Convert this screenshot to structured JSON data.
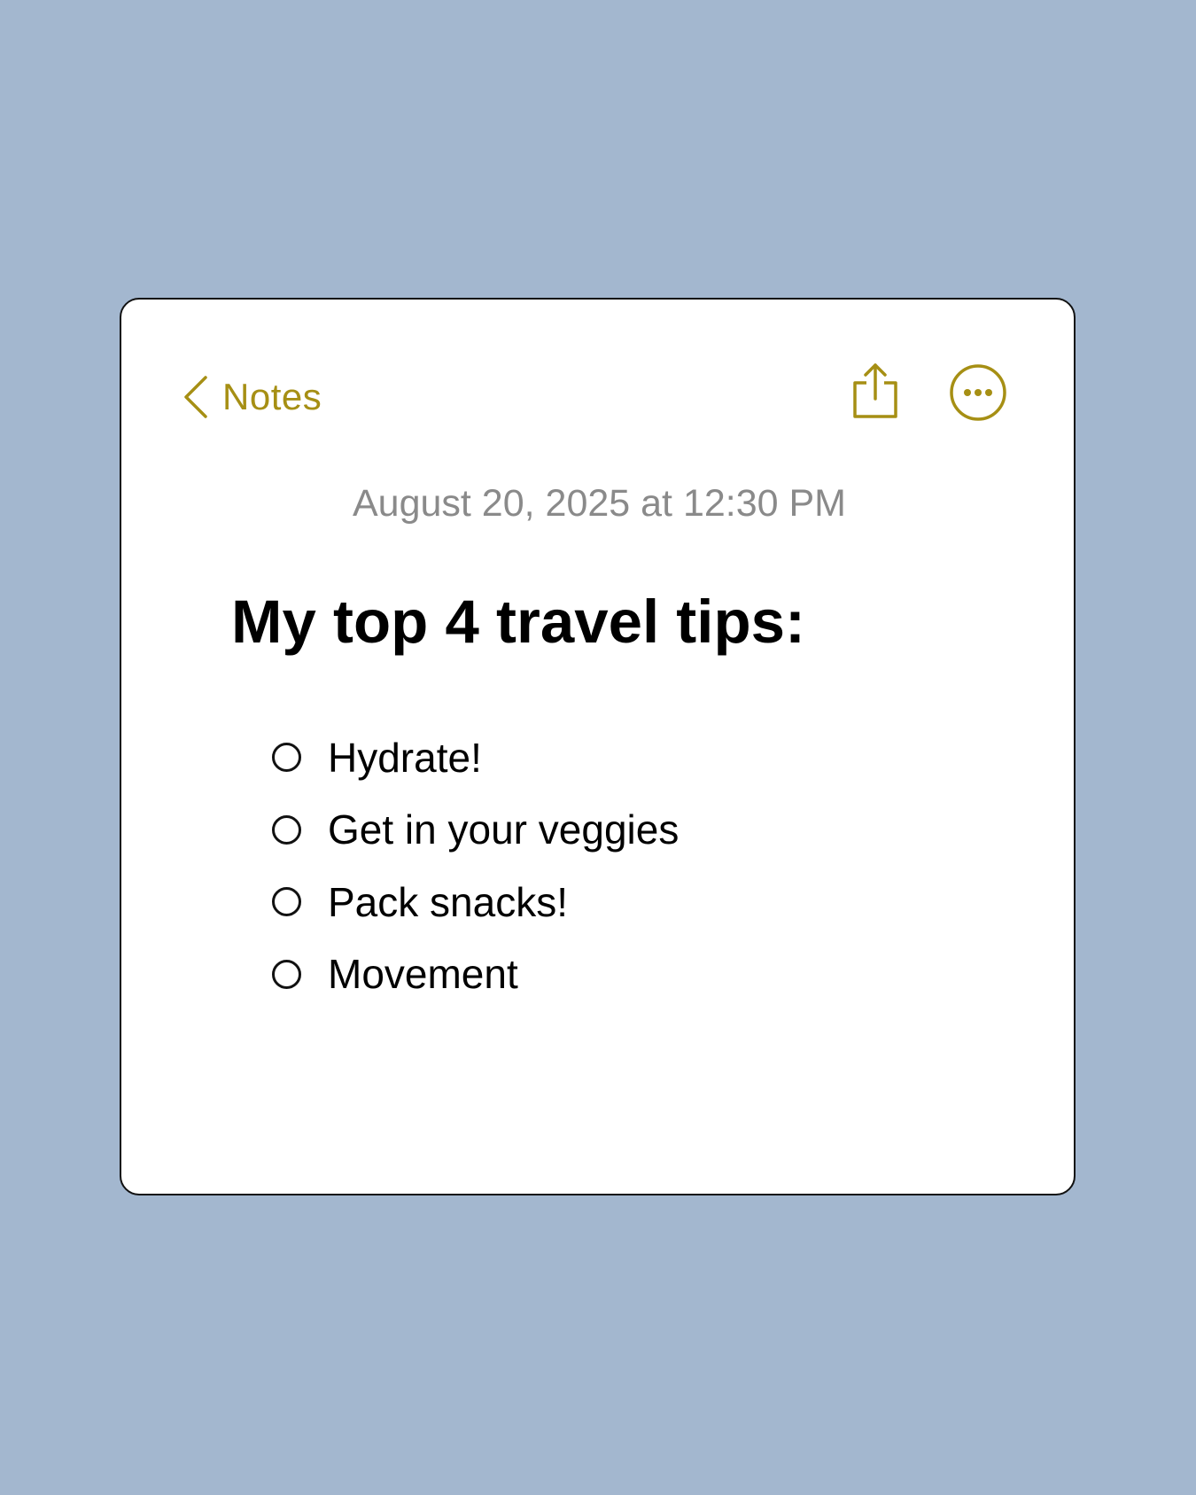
{
  "colors": {
    "background": "#a3b7cf",
    "card": "#ffffff",
    "accent": "#a68f14",
    "timestamp": "#8a8a8a",
    "text": "#000000"
  },
  "nav": {
    "back_label": "Notes",
    "back_icon": "chevron-left-icon",
    "share_icon": "share-icon",
    "more_icon": "more-ellipsis-icon"
  },
  "note": {
    "timestamp": "August 20, 2025 at 12:30 PM",
    "title": "My top 4 travel tips:",
    "checklist": [
      {
        "text": "Hydrate!",
        "checked": false
      },
      {
        "text": "Get in your veggies",
        "checked": false
      },
      {
        "text": "Pack snacks!",
        "checked": false
      },
      {
        "text": "Movement",
        "checked": false
      }
    ]
  }
}
